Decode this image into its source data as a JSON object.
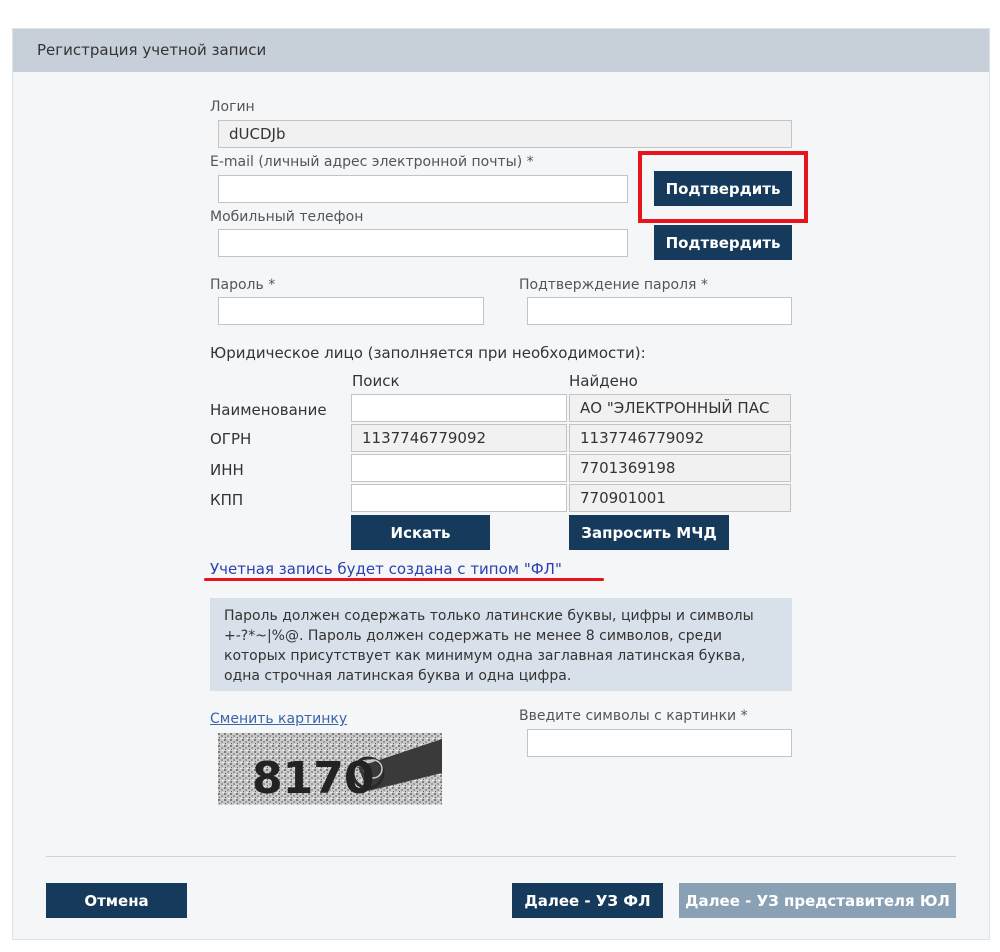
{
  "header": {
    "title": "Регистрация учетной записи"
  },
  "login": {
    "label": "Логин",
    "value": "dUCDJb"
  },
  "email": {
    "label": "E-mail (личный адрес электронной почты) *",
    "value": "",
    "confirm_label": "Подтвердить"
  },
  "phone": {
    "label": "Мобильный телефон",
    "value": "",
    "confirm_label": "Подтвердить"
  },
  "password": {
    "label": "Пароль *",
    "value": ""
  },
  "password_confirm": {
    "label": "Подтверждение пароля *",
    "value": ""
  },
  "legal_entity": {
    "title": "Юридическое лицо (заполняется при необходимости):",
    "col_search": "Поиск",
    "col_found": "Найдено",
    "rows": [
      {
        "label": "Наименование",
        "search": "",
        "found": "АО \"ЭЛЕКТРОННЫЙ ПАС"
      },
      {
        "label": "ОГРН",
        "search": "1137746779092",
        "found": "1137746779092"
      },
      {
        "label": "ИНН",
        "search": "",
        "found": "7701369198"
      },
      {
        "label": "КПП",
        "search": "",
        "found": "770901001"
      }
    ],
    "search_button": "Искать",
    "request_button": "Запросить МЧД"
  },
  "account_type_note": "Учетная запись будет создана с типом \"ФЛ\"",
  "password_rules": "Пароль должен содержать только латинские буквы, цифры и символы +-?*~|%@. Пароль должен содержать не менее 8 символов, среди которых присутствует как минимум одна заглавная латинская буква, одна строчная латинская буква и одна цифра.",
  "captcha": {
    "change_link": "Сменить картинку",
    "input_label": "Введите символы с картинки *",
    "value": "",
    "image_text": "8170"
  },
  "footer": {
    "cancel": "Отмена",
    "next_fl": "Далее - УЗ ФЛ",
    "next_ul": "Далее - УЗ представителя ЮЛ"
  },
  "colors": {
    "button": "#153a5c",
    "button_muted": "#8aa0b5",
    "highlight": "#e8141c",
    "header_bg": "#c7d0d9",
    "info_bg": "#d8e1ea"
  }
}
